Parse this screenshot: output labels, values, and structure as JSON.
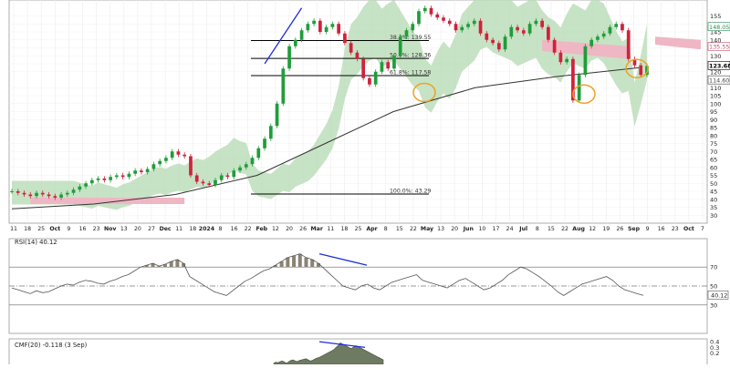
{
  "chart_data": {
    "type": "candlestick",
    "x_ticks": [
      "11",
      "18",
      "25",
      "Oct",
      "9",
      "16",
      "23",
      "Nov",
      "13",
      "20",
      "27",
      "Dec",
      "11",
      "18",
      "2024",
      "8",
      "16",
      "22",
      "Feb",
      "12",
      "20",
      "26",
      "Mar",
      "11",
      "18",
      "25",
      "Apr",
      "8",
      "15",
      "22",
      "May",
      "13",
      "20",
      "Jun",
      "10",
      "17",
      "24",
      "Jul",
      "8",
      "15",
      "22",
      "Aug",
      "12",
      "19",
      "26",
      "Sep",
      "9",
      "16",
      "23",
      "Oct",
      "7"
    ],
    "price_axis": {
      "ticks": [
        30,
        35,
        40,
        45,
        50,
        55,
        60,
        65,
        70,
        75,
        80,
        85,
        90,
        95,
        100,
        105,
        110,
        120,
        125,
        130,
        135,
        140,
        145,
        150,
        155
      ],
      "ylim": [
        25,
        165
      ],
      "labels": [
        {
          "text": "148.05",
          "value": 148.05,
          "color": "#2e8b57"
        },
        {
          "text": "135.55",
          "value": 135.55,
          "color": "#c0506a"
        },
        {
          "text": "123.68",
          "value": 123.68,
          "color": "#000000"
        },
        {
          "text": "114.60",
          "value": 114.6,
          "color": "#444444"
        }
      ]
    },
    "price": [
      45,
      44,
      43,
      42,
      44,
      43,
      42,
      41,
      43,
      44,
      46,
      48,
      50,
      52,
      53,
      52,
      54,
      55,
      54,
      56,
      58,
      57,
      59,
      62,
      64,
      66,
      70,
      68,
      67,
      55,
      51,
      50,
      49,
      52,
      55,
      54,
      58,
      60,
      62,
      66,
      72,
      78,
      86,
      100,
      122,
      136,
      140,
      146,
      150,
      152,
      145,
      148,
      150,
      144,
      138,
      132,
      128,
      116,
      112,
      120,
      126,
      122,
      130,
      142,
      146,
      150,
      158,
      160,
      156,
      154,
      152,
      150,
      146,
      148,
      150,
      152,
      144,
      140,
      138,
      134,
      142,
      148,
      146,
      144,
      150,
      152,
      148,
      140,
      132,
      126,
      128,
      102,
      118,
      136,
      140,
      142,
      144,
      148,
      150,
      146,
      128,
      124,
      118,
      123.68
    ],
    "sma": [
      [
        0,
        34
      ],
      [
        30,
        37
      ],
      [
        60,
        43
      ],
      [
        90,
        55
      ],
      [
        115,
        75
      ],
      [
        140,
        95
      ],
      [
        170,
        110
      ],
      [
        200,
        117
      ],
      [
        230,
        122.5
      ]
    ],
    "fib_levels": [
      {
        "label": "38.2%: 139.55",
        "value": 139.55
      },
      {
        "label": "50.0%: 128.36",
        "value": 128.36
      },
      {
        "label": "61.8%: 117.58",
        "value": 117.58
      },
      {
        "label": "100.0%: 43.29",
        "value": 43.29
      }
    ],
    "rsi": {
      "title": "RSI(14) 40.12",
      "ticks": [
        30,
        50,
        70
      ],
      "ylim": [
        0,
        100
      ],
      "last": "40.12",
      "values": [
        48,
        46,
        44,
        42,
        45,
        43,
        44,
        47,
        50,
        52,
        51,
        54,
        56,
        55,
        53,
        52,
        55,
        57,
        60,
        62,
        66,
        70,
        72,
        74,
        71,
        73,
        76,
        78,
        74,
        60,
        56,
        52,
        48,
        44,
        42,
        40,
        45,
        50,
        55,
        58,
        62,
        66,
        68,
        72,
        76,
        80,
        82,
        84,
        80,
        78,
        74,
        68,
        62,
        56,
        50,
        48,
        46,
        50,
        52,
        48,
        46,
        50,
        54,
        56,
        58,
        60,
        62,
        56,
        54,
        52,
        50,
        48,
        52,
        56,
        58,
        54,
        50,
        46,
        48,
        52,
        56,
        62,
        66,
        70,
        68,
        64,
        60,
        55,
        50,
        44,
        40,
        44,
        48,
        52,
        54,
        56,
        58,
        60,
        56,
        50,
        46,
        44,
        42,
        40.12
      ]
    },
    "cmf": {
      "title": "CMF(20) -0.118 (3 Sep)",
      "ticks": [
        0.2,
        0.3,
        0.4
      ],
      "ylim": [
        -0.4,
        0.45
      ],
      "values": [
        0.02,
        0.04,
        0.03,
        0.05,
        0.06,
        0.04,
        0.02,
        0.05,
        0.07,
        0.08,
        0.06,
        0.05,
        0.07,
        0.08,
        0.09,
        0.1,
        0.08,
        0.06,
        0.07,
        0.09,
        0.11,
        0.12,
        0.14,
        0.16,
        0.18,
        0.2,
        0.22,
        0.24,
        0.26,
        0.3,
        0.33,
        0.38,
        0.36,
        0.34,
        0.32,
        0.3,
        0.28,
        0.3,
        0.33,
        0.32,
        0.3,
        0.28,
        0.26,
        0.24,
        0.22,
        0.2,
        0.18,
        0.16,
        0.14,
        0.12,
        0.1,
        0.08
      ]
    },
    "colors": {
      "up": "#1f9d3a",
      "down": "#d0223c",
      "sma": "#333333",
      "cloud_bull": "#b9dcb6",
      "cloud_bear": "#efb6c4",
      "fib": "#000000",
      "divergence": "#1f2fd6",
      "circle": "#f0a020",
      "rsi_fill": "#8a8474",
      "cmf_fill": "#6f7a62"
    }
  }
}
